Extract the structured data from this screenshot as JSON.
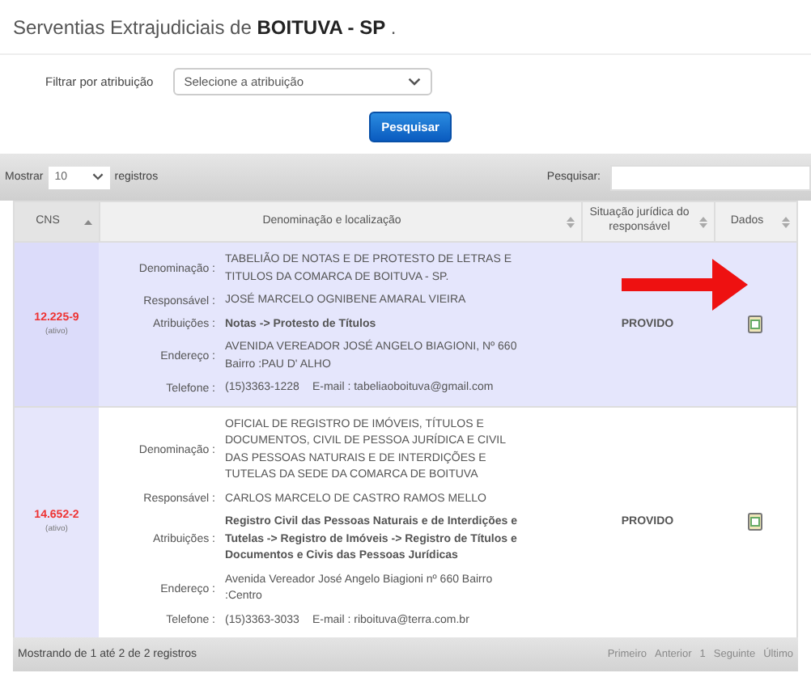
{
  "title": {
    "prefix": "Serventias Extrajudiciais de ",
    "city": "BOITUVA - SP",
    "suffix": " ."
  },
  "filter": {
    "label": "Filtrar por atribuição",
    "placeholder": "Selecione a atribuição"
  },
  "search_button": "Pesquisar",
  "toolbar": {
    "show_label": "Mostrar",
    "page_size": "10",
    "records_label": "registros",
    "search_label": "Pesquisar:"
  },
  "table": {
    "columns": [
      {
        "label": "CNS",
        "sorted": true
      },
      {
        "label": "Denominação e localização",
        "sorted": false
      },
      {
        "label": "Situação jurídica do responsável",
        "sorted": false
      },
      {
        "label": "Dados",
        "sorted": false
      }
    ],
    "rows": [
      {
        "selected": true,
        "cns": "12.225-9",
        "status": "(ativo)",
        "fields": [
          {
            "label": "Denominação :",
            "value": "TABELIÃO DE NOTAS E DE PROTESTO DE LETRAS E TITULOS DA COMARCA DE BOITUVA - SP.",
            "bold": false
          },
          {
            "label": "Responsável :",
            "value": "JOSÉ MARCELO OGNIBENE AMARAL VIEIRA",
            "bold": false
          },
          {
            "label": "Atribuições :",
            "value": "Notas -> Protesto de Títulos",
            "bold": true
          },
          {
            "label": "Endereço :",
            "value": "AVENIDA VEREADOR JOSÉ ANGELO BIAGIONI, Nº 660   Bairro :PAU D' ALHO",
            "bold": false
          }
        ],
        "phone_label": "Telefone :",
        "phone": "(15)3363-1228",
        "email": "E-mail : tabeliaoboituva@gmail.com",
        "situation": "PROVIDO"
      },
      {
        "selected": false,
        "cns": "14.652-2",
        "status": "(ativo)",
        "fields": [
          {
            "label": "Denominação :",
            "value": "OFICIAL DE REGISTRO DE IMÓVEIS, TÍTULOS E DOCUMENTOS, CIVIL DE PESSOA JURÍDICA E CIVIL DAS PESSOAS NATURAIS E DE INTERDIÇÕES E TUTELAS DA SEDE DA COMARCA DE BOITUVA",
            "bold": false
          },
          {
            "label": "Responsável :",
            "value": "CARLOS MARCELO DE CASTRO RAMOS MELLO",
            "bold": false
          },
          {
            "label": "Atribuições :",
            "value": "Registro Civil das Pessoas Naturais e de Interdições e Tutelas -> Registro de Imóveis -> Registro de Títulos e Documentos e Civis das Pessoas Jurídicas",
            "bold": true
          },
          {
            "label": "Endereço :",
            "value": "Avenida Vereador José Angelo Biagioni nº 660    Bairro :Centro",
            "bold": false
          }
        ],
        "phone_label": "Telefone :",
        "phone": "(15)3363-3033",
        "email": "E-mail : riboituva@terra.com.br",
        "situation": "PROVIDO"
      }
    ]
  },
  "footer": {
    "info": "Mostrando de 1 até 2 de 2 registros",
    "pages": [
      {
        "label": "Primeiro",
        "disabled": true
      },
      {
        "label": "Anterior",
        "disabled": true
      },
      {
        "label": "1",
        "disabled": true
      },
      {
        "label": "Seguinte",
        "disabled": true
      },
      {
        "label": "Último",
        "disabled": true
      }
    ]
  }
}
